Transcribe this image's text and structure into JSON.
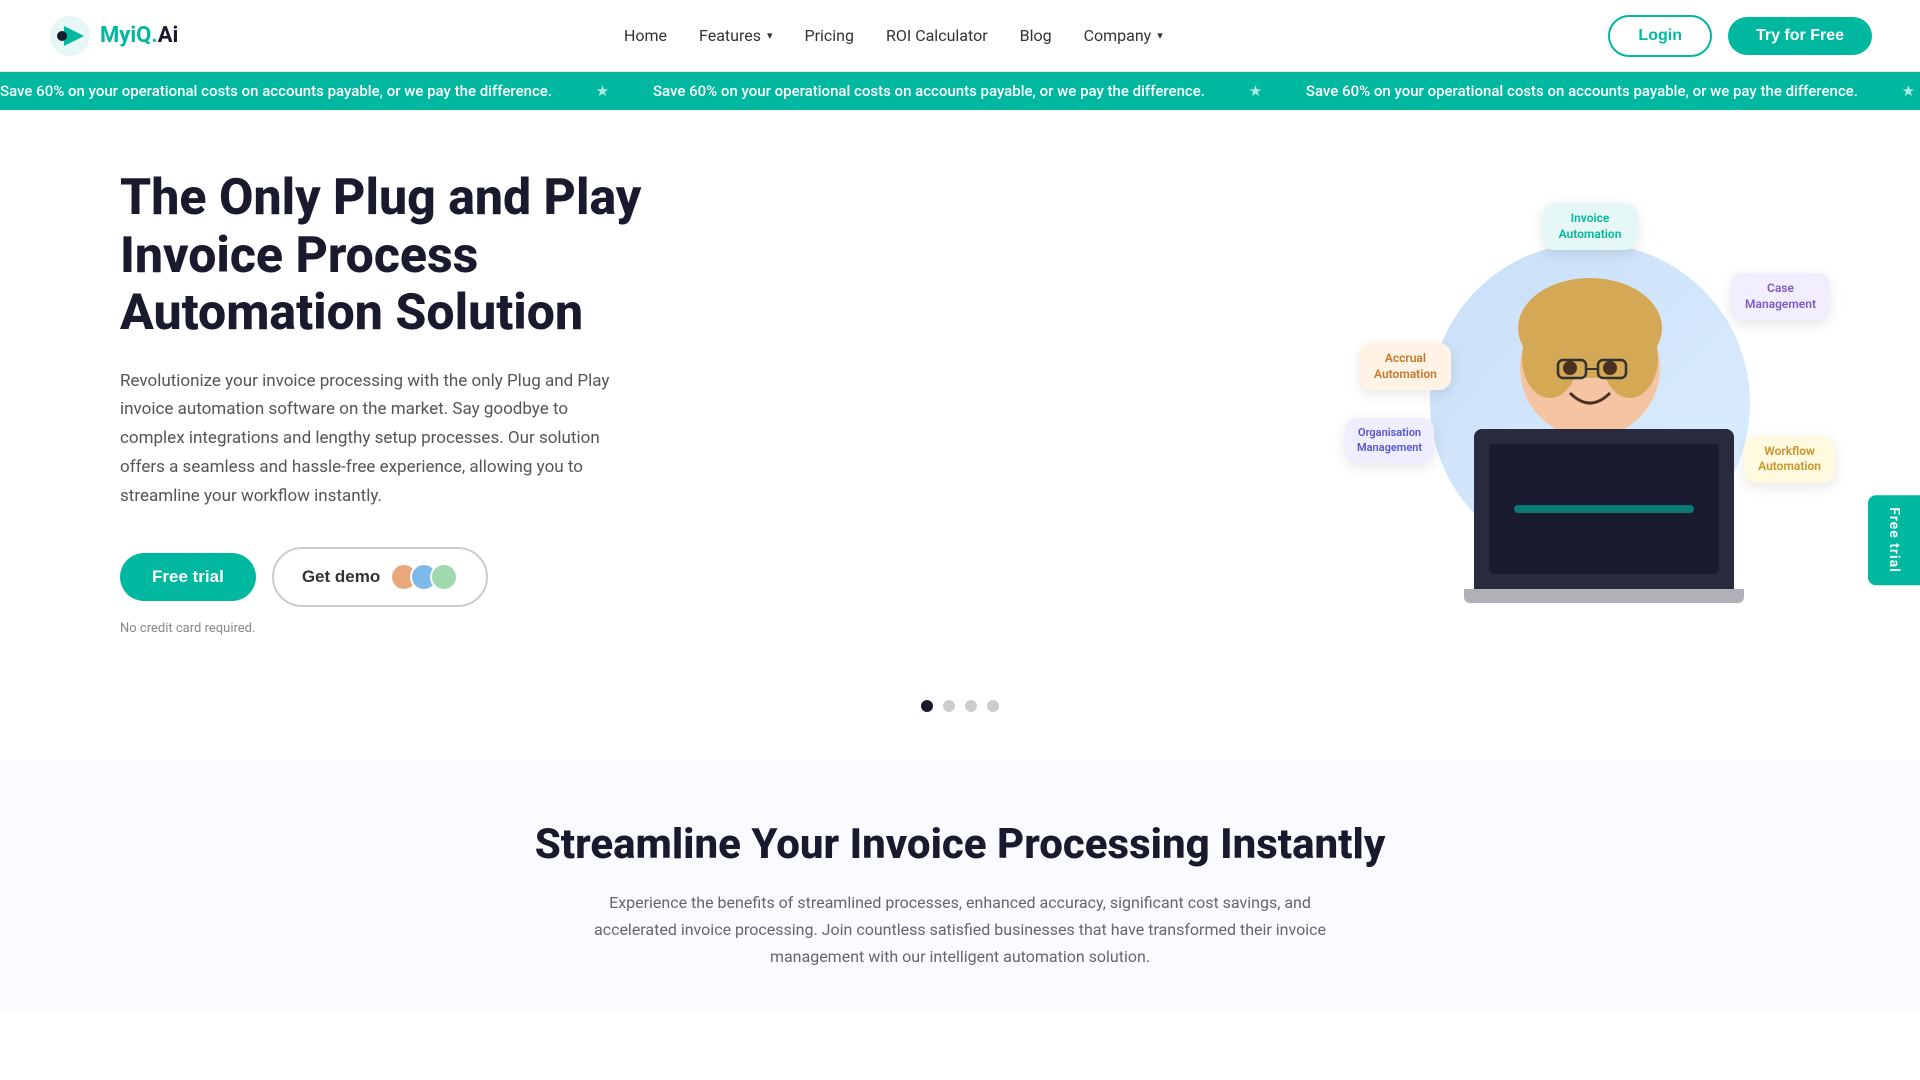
{
  "brand": {
    "name_part1": "MyiQ.",
    "name_part2": "Ai",
    "logo_alt": "MyiQ.Ai logo"
  },
  "nav": {
    "home": "Home",
    "features": "Features",
    "pricing": "Pricing",
    "roi_calculator": "ROI Calculator",
    "blog": "Blog",
    "company": "Company",
    "login": "Login",
    "try_free": "Try for Free"
  },
  "ticker": {
    "message": "Save 60% on your operational costs on accounts payable, or we pay the difference.",
    "separator": "★"
  },
  "hero": {
    "title": "The Only Plug and Play Invoice Process Automation Solution",
    "description": "Revolutionize your invoice processing with the only Plug and Play invoice automation software on the market. Say goodbye to complex integrations and lengthy setup processes. Our solution offers a seamless and hassle-free experience, allowing you to streamline your workflow instantly.",
    "free_trial_btn": "Free trial",
    "get_demo_btn": "Get demo",
    "no_cc": "No credit card required.",
    "bubbles": {
      "invoice_automation": "Invoice\nAutomation",
      "accrual_automation": "Accrual\nAutomation",
      "case_management": "Case\nManagement",
      "organisation_management": "Organisation\nManagement",
      "workflow_automation": "Workflow\nAutomation"
    }
  },
  "carousel": {
    "active_dot": 0,
    "total_dots": 4
  },
  "streamline": {
    "title": "Streamline Your Invoice Processing Instantly",
    "description": "Experience the benefits of streamlined processes, enhanced accuracy, significant cost savings, and accelerated invoice processing. Join countless satisfied businesses that have transformed their invoice management with our intelligent automation solution."
  },
  "floating": {
    "label": "Free trial"
  },
  "colors": {
    "brand_teal": "#00b8a0",
    "dark_navy": "#1a1a2e"
  }
}
